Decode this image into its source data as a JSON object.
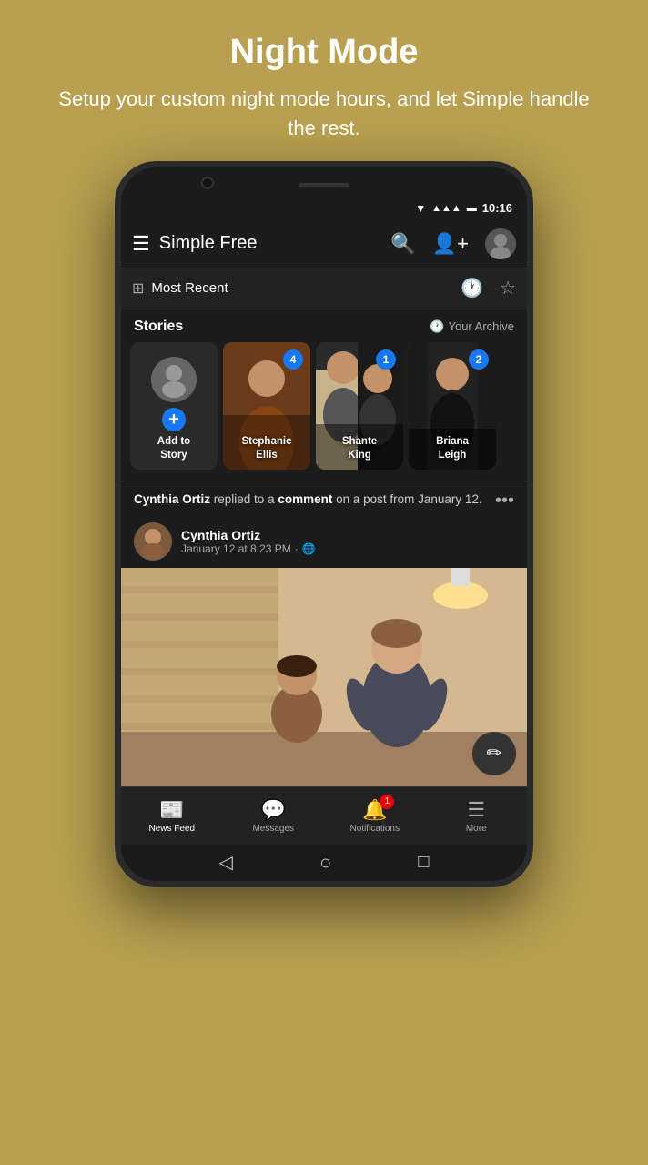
{
  "header": {
    "title": "Night Mode",
    "subtitle": "Setup your custom night mode hours, and let Simple handle the rest."
  },
  "statusBar": {
    "time": "10:16",
    "wifi": "▼",
    "signal": "▲",
    "battery": "🔋"
  },
  "appBar": {
    "title": "Simple Free",
    "searchLabel": "search",
    "addFriendLabel": "add friend",
    "profileLabel": "profile"
  },
  "filterBar": {
    "label": "Most Recent",
    "historyLabel": "history",
    "starLabel": "starred"
  },
  "stories": {
    "title": "Stories",
    "archiveLabel": "Your Archive",
    "items": [
      {
        "label": "Add to Story",
        "type": "add",
        "count": null
      },
      {
        "label": "Stephanie Ellis",
        "type": "photo",
        "count": 4,
        "colorClass": "story-photo-2"
      },
      {
        "label": "Shante King",
        "type": "photo",
        "count": 1,
        "colorClass": "story-photo-3"
      },
      {
        "label": "Briana Leigh",
        "type": "photo",
        "count": 2,
        "colorClass": "story-photo-4"
      }
    ]
  },
  "post": {
    "headerText": " replied to a ",
    "authorName": "Cynthia Ortiz",
    "actionText": "comment",
    "trailText": " on a post from January 12.",
    "metaAuthor": "Cynthia Ortiz",
    "metaTime": "January 12 at 8:23 PM",
    "metaGlobe": "🌐"
  },
  "bottomNav": {
    "items": [
      {
        "label": "News Feed",
        "icon": "📰",
        "active": true,
        "badge": null
      },
      {
        "label": "Messages",
        "icon": "💬",
        "active": false,
        "badge": null
      },
      {
        "label": "Notifications",
        "icon": "🔔",
        "active": false,
        "badge": "1"
      },
      {
        "label": "More",
        "icon": "☰",
        "active": false,
        "badge": null
      }
    ]
  },
  "phoneBottom": {
    "back": "◁",
    "home": "○",
    "recent": "□"
  },
  "colors": {
    "background": "#b8a050",
    "screen": "#1c1c1c",
    "accent": "#1877f2"
  }
}
